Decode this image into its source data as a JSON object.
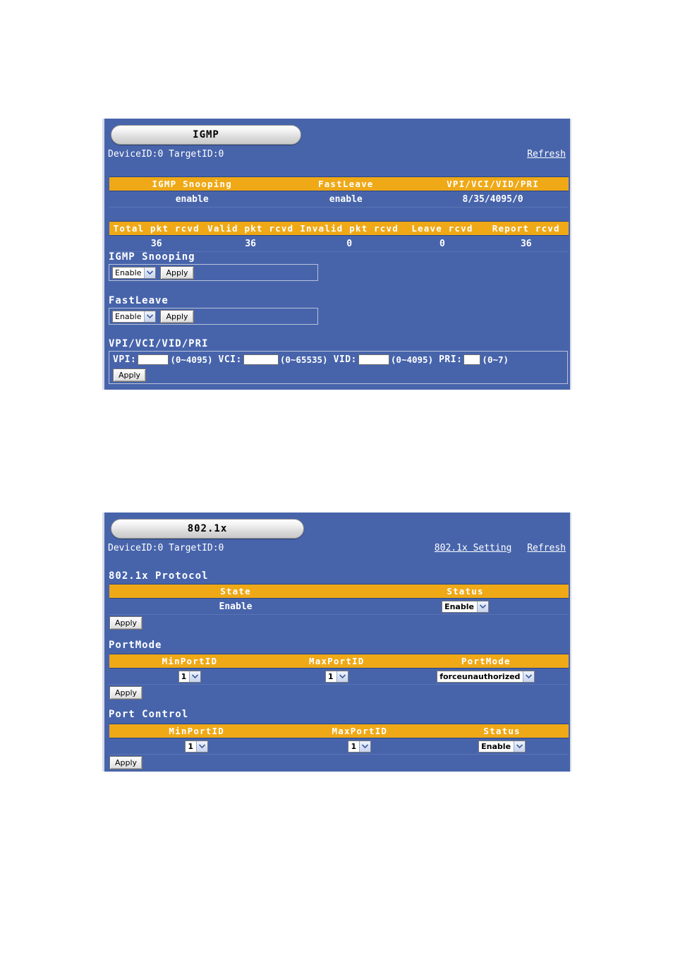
{
  "panels": [
    {
      "title": "IGMP",
      "id_line": "DeviceID:0 TargetID:0",
      "links": [
        "Refresh"
      ],
      "status_table": {
        "headers": [
          "IGMP Snooping",
          "FastLeave",
          "VPI/VCI/VID/PRI"
        ],
        "values": [
          "enable",
          "enable",
          "8/35/4095/0"
        ]
      },
      "stats_table": {
        "headers": [
          "Total pkt rcvd",
          "Valid pkt rcvd",
          "Invalid pkt rcvd",
          "Leave rcvd",
          "Report rcvd"
        ],
        "values": [
          "36",
          "36",
          "0",
          "0",
          "36"
        ]
      },
      "igmp_snooping": {
        "label": "IGMP Snooping",
        "select_value": "Enable",
        "apply_label": "Apply"
      },
      "fastleave": {
        "label": "FastLeave",
        "select_value": "Enable",
        "apply_label": "Apply"
      },
      "vpi_section": {
        "label": "VPI/VCI/VID/PRI",
        "fields": [
          {
            "label": "VPI:",
            "value": "",
            "hint": "(0~4095)"
          },
          {
            "label": "VCI:",
            "value": "",
            "hint": "(0~65535)"
          },
          {
            "label": "VID:",
            "value": "",
            "hint": "(0~4095)"
          },
          {
            "label": "PRI:",
            "value": "",
            "hint": "(0~7)"
          }
        ],
        "apply_label": "Apply"
      }
    },
    {
      "title": "802.1x",
      "id_line": "DeviceID:0 TargetID:0",
      "links": [
        "802.1x Setting",
        "Refresh"
      ],
      "protocol": {
        "label": "802.1x Protocol",
        "headers": [
          "State",
          "Status"
        ],
        "state_value": "Enable",
        "status_select": "Enable",
        "apply_label": "Apply"
      },
      "portmode": {
        "label": "PortMode",
        "headers": [
          "MinPortID",
          "MaxPortID",
          "PortMode"
        ],
        "min_port": "1",
        "max_port": "1",
        "mode": "forceunauthorized",
        "apply_label": "Apply"
      },
      "portcontrol": {
        "label": "Port Control",
        "headers": [
          "MinPortID",
          "MaxPortID",
          "Status"
        ],
        "min_port": "1",
        "max_port": "1",
        "status": "Enable",
        "apply_label": "Apply"
      }
    }
  ],
  "colors": {
    "panel_bg": "#4764AB",
    "header_orange": "#EFA917",
    "text": "#FFFFFF",
    "page_bg": "#FFFFFF"
  },
  "icons": {
    "dropdown": "chevron-down-icon"
  }
}
